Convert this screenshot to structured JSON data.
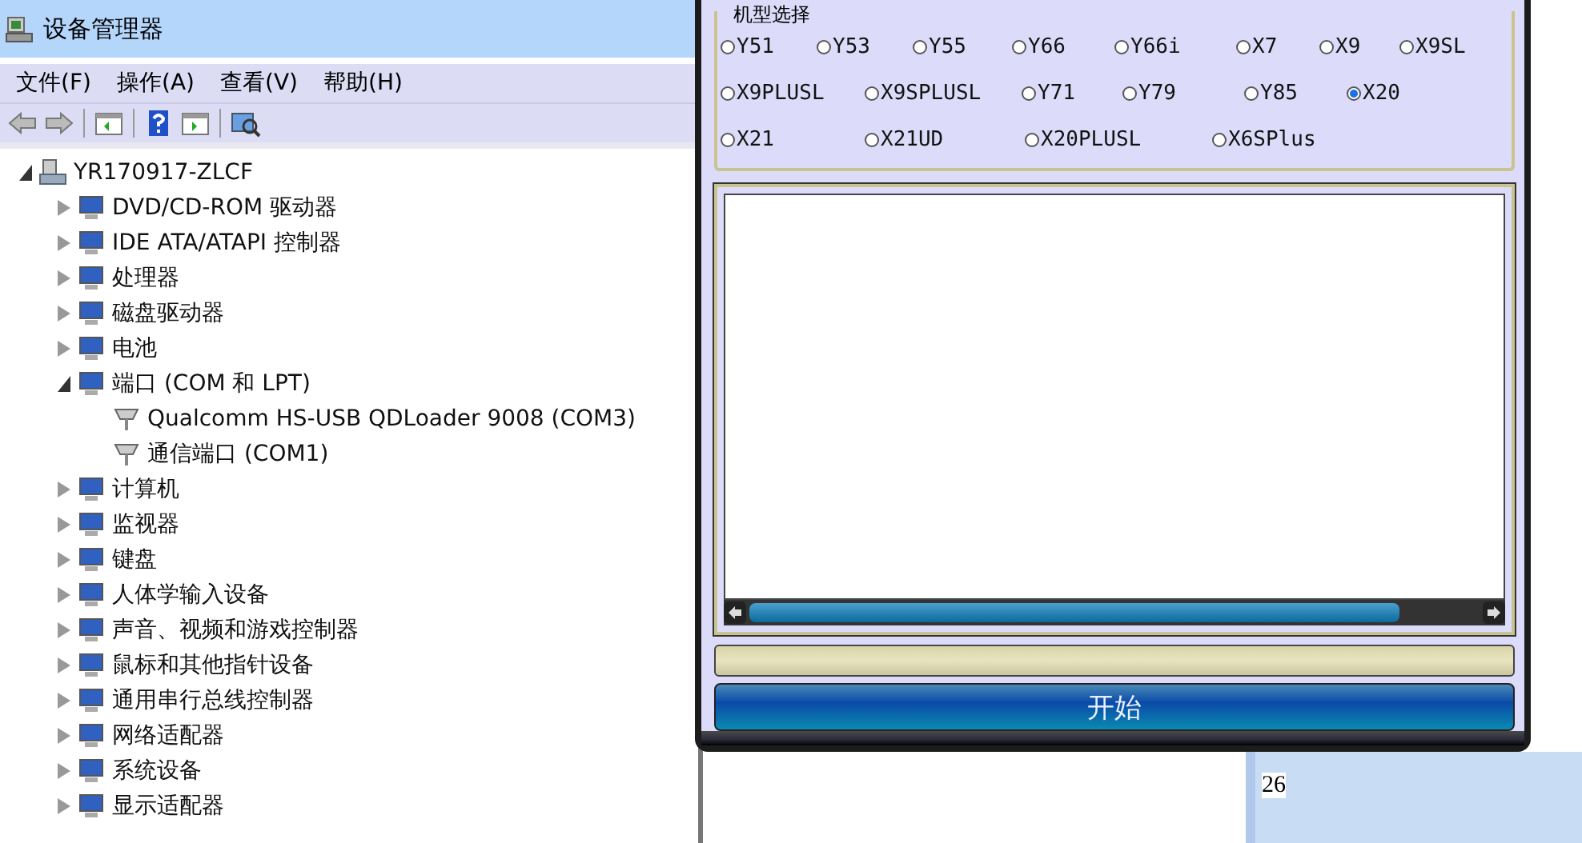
{
  "device_manager": {
    "window": {
      "title": "设备管理器"
    },
    "menu": [
      "文件(F)",
      "操作(A)",
      "查看(V)",
      "帮助(H)"
    ],
    "tree": {
      "label": "YR170917-ZLCF",
      "expanded": true,
      "children": [
        {
          "label": "DVD/CD-ROM 驱动器",
          "expanded": false
        },
        {
          "label": "IDE ATA/ATAPI 控制器",
          "expanded": false
        },
        {
          "label": "处理器",
          "expanded": false
        },
        {
          "label": "磁盘驱动器",
          "expanded": false
        },
        {
          "label": "电池",
          "expanded": false
        },
        {
          "label": "端口 (COM 和 LPT)",
          "expanded": true,
          "children": [
            {
              "label": "Qualcomm HS-USB QDLoader 9008 (COM3)"
            },
            {
              "label": "通信端口 (COM1)"
            }
          ]
        },
        {
          "label": "计算机",
          "expanded": false
        },
        {
          "label": "监视器",
          "expanded": false
        },
        {
          "label": "键盘",
          "expanded": false
        },
        {
          "label": "人体学输入设备",
          "expanded": false
        },
        {
          "label": "声音、视频和游戏控制器",
          "expanded": false
        },
        {
          "label": "鼠标和其他指针设备",
          "expanded": false
        },
        {
          "label": "通用串行总线控制器",
          "expanded": false
        },
        {
          "label": "网络适配器",
          "expanded": false
        },
        {
          "label": "系统设备",
          "expanded": false
        },
        {
          "label": "显示适配器",
          "expanded": false
        }
      ]
    }
  },
  "flash_tool": {
    "model_group": {
      "title": "机型选择",
      "options": [
        {
          "label": "Y51",
          "selected": false
        },
        {
          "label": "Y53",
          "selected": false
        },
        {
          "label": "Y55",
          "selected": false
        },
        {
          "label": "Y66",
          "selected": false
        },
        {
          "label": "Y66i",
          "selected": false
        },
        {
          "label": "X7",
          "selected": false
        },
        {
          "label": "X9",
          "selected": false
        },
        {
          "label": "X9SL",
          "selected": false
        },
        {
          "label": "X9PLUSL",
          "selected": false
        },
        {
          "label": "X9SPLUSL",
          "selected": false
        },
        {
          "label": "Y71",
          "selected": false
        },
        {
          "label": "Y79",
          "selected": false
        },
        {
          "label": "Y85",
          "selected": false
        },
        {
          "label": "X20",
          "selected": true
        },
        {
          "label": "X21",
          "selected": false
        },
        {
          "label": "X21UD",
          "selected": false
        },
        {
          "label": "X20PLUSL",
          "selected": false
        },
        {
          "label": "X6SPlus",
          "selected": false
        }
      ]
    },
    "progress": {
      "level": 0
    },
    "start_button": "开始"
  },
  "background_window": {
    "text": "26"
  }
}
